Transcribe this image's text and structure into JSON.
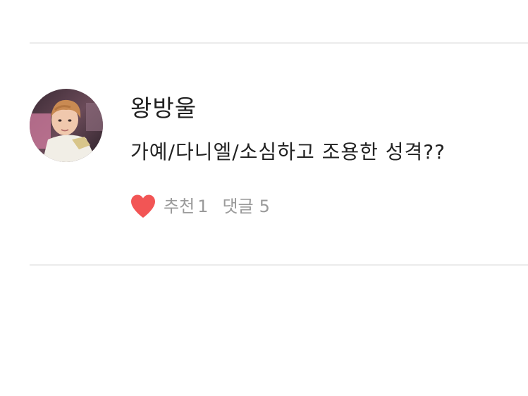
{
  "post": {
    "author": "왕방울",
    "content": "가예/다니엘/소심하고 조용한 성격??",
    "like_label": "추천",
    "like_count": "1",
    "comment_label": "댓글",
    "comment_count": "5",
    "like_icon": "heart-icon",
    "like_color": "#f25555"
  }
}
